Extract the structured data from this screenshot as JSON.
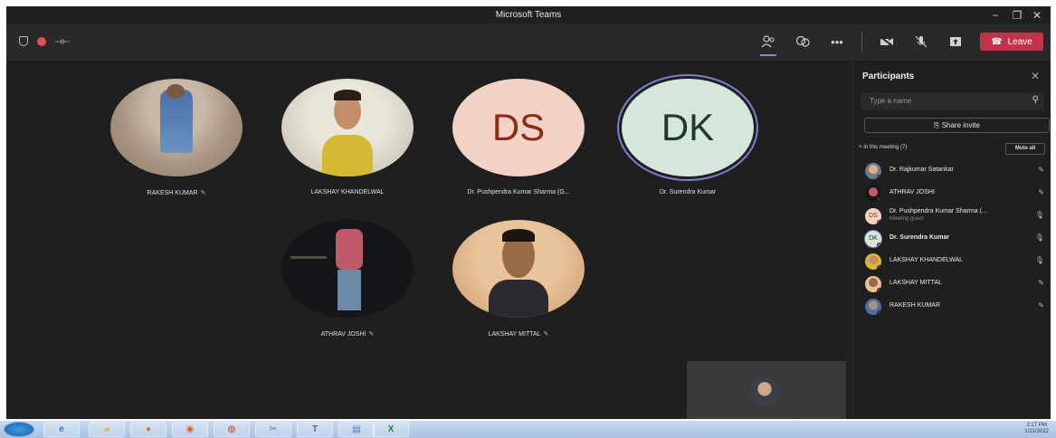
{
  "window": {
    "title": "Microsoft Teams",
    "controls": [
      "−",
      "❐",
      "✕"
    ]
  },
  "toolbar": {
    "leave_label": "Leave",
    "icons": [
      "participants-icon",
      "chat-icon",
      "more-icon",
      "camera-off-icon",
      "mic-off-icon",
      "share-icon"
    ]
  },
  "stage": {
    "tiles": [
      {
        "name": "RAKESH KUMAR",
        "muted": true,
        "type": "photo"
      },
      {
        "name": "LAKSHAY KHANDELWAL",
        "muted": false,
        "type": "photo"
      },
      {
        "name": "Dr. Pushpendra Kumar Sharma (G...",
        "muted": false,
        "type": "initials",
        "initials": "DS"
      },
      {
        "name": "Dr. Surendra Kumar",
        "muted": false,
        "type": "initials",
        "initials": "DK"
      },
      {
        "name": "ATHRAV JOSHI",
        "muted": true,
        "type": "photo"
      },
      {
        "name": "LAKSHAY MITTAL",
        "muted": true,
        "type": "photo"
      }
    ]
  },
  "panel": {
    "title": "Participants",
    "search_placeholder": "Type a name",
    "share_invite": "Share invite",
    "section_label": "In this meeting (7)",
    "mute_all": "Mute all",
    "participants": [
      {
        "name": "Dr. Rajkumar Satankar",
        "sub": "",
        "muted": true
      },
      {
        "name": "ATHRAV JOSHI",
        "sub": "",
        "muted": true
      },
      {
        "name": "Dr. Pushpendra Kumar Sharma (...",
        "sub": "Meeting guest",
        "muted": false,
        "initials": "DS"
      },
      {
        "name": "Dr. Surendra Kumar",
        "sub": "",
        "muted": false,
        "initials": "DK"
      },
      {
        "name": "LAKSHAY KHANDELWAL",
        "sub": "",
        "muted": false
      },
      {
        "name": "LAKSHAY MITTAL",
        "sub": "",
        "muted": true
      },
      {
        "name": "RAKESH KUMAR",
        "sub": "",
        "muted": true
      }
    ]
  },
  "taskbar": {
    "time": "2:27 PM",
    "date": "1/21/2022"
  }
}
